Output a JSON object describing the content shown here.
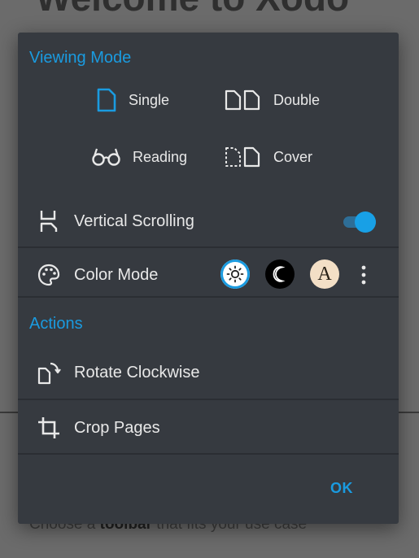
{
  "background": {
    "title": "Welcome to Xodo",
    "subtitle_prefix": "Choose a ",
    "subtitle_bold": "toolbar",
    "subtitle_suffix": " that fits your use case"
  },
  "dialog": {
    "viewing_mode_title": "Viewing Mode",
    "modes": {
      "single": "Single",
      "double": "Double",
      "reading": "Reading",
      "cover": "Cover"
    },
    "selected_mode": "Single",
    "vertical_scrolling": {
      "label": "Vertical Scrolling",
      "enabled": true
    },
    "color_mode": {
      "label": "Color Mode",
      "options": [
        "light-icon",
        "dark-icon",
        "sepia-icon"
      ],
      "selected": "light",
      "sepia_glyph": "A"
    },
    "actions_title": "Actions",
    "actions": {
      "rotate": "Rotate Clockwise",
      "crop": "Crop Pages"
    },
    "ok_label": "OK"
  },
  "colors": {
    "accent": "#1a9be0",
    "dialog_bg": "#363a40",
    "text": "#e8e8e8"
  }
}
